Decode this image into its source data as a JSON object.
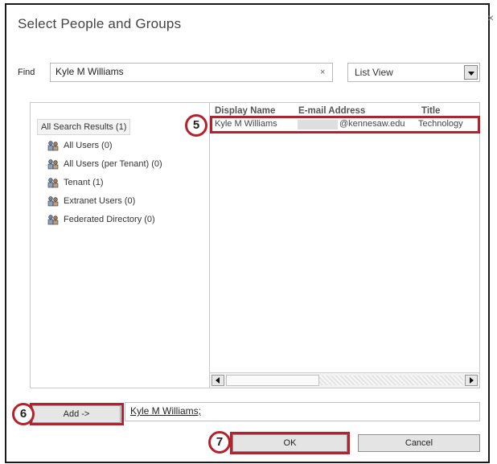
{
  "dialog": {
    "title": "Select People and Groups",
    "close_symbol": "×"
  },
  "find": {
    "label": "Find",
    "value": "Kyle M Williams",
    "clear_symbol": "×"
  },
  "view": {
    "selected": "List View"
  },
  "tree": {
    "header": "All Search Results (1)",
    "items": [
      {
        "label": "All Users (0)",
        "icon": "users-icon"
      },
      {
        "label": "All Users (per Tenant) (0)",
        "icon": "users-icon"
      },
      {
        "label": "Tenant (1)",
        "icon": "users-icon"
      },
      {
        "label": "Extranet Users (0)",
        "icon": "users-icon"
      },
      {
        "label": "Federated Directory (0)",
        "icon": "users-icon"
      }
    ]
  },
  "results": {
    "columns": [
      "Display Name",
      "E-mail Address",
      "Title"
    ],
    "rows": [
      {
        "display_name": "Kyle M Williams",
        "email": "@kennesaw.edu",
        "title": "Technology"
      }
    ]
  },
  "steps": {
    "five": "5",
    "six": "6",
    "seven": "7"
  },
  "buttons": {
    "add": "Add ->",
    "ok": "OK",
    "cancel": "Cancel"
  },
  "added": {
    "value": "Kyle M Williams;"
  },
  "colors": {
    "highlight": "#b4232d"
  }
}
